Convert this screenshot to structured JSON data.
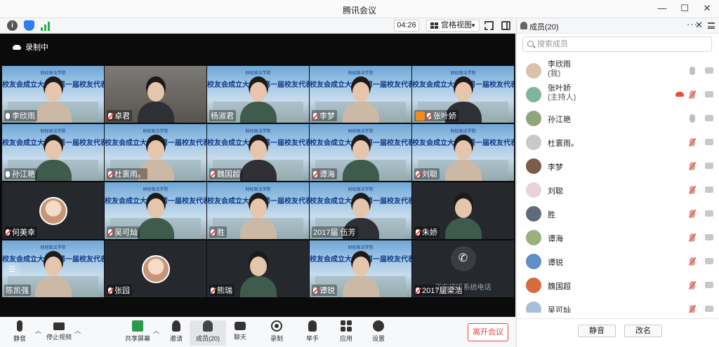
{
  "window": {
    "title": "腾讯会议"
  },
  "infobar": {
    "timer": "04:26",
    "view_mode": "宫格视图"
  },
  "stage": {
    "recording_label": "录制中"
  },
  "banner": {
    "title_text": "校友会成立大会暨第一届校友代表大会",
    "school_text": "财经政法学院"
  },
  "tiles": [
    {
      "name": "李欣雨",
      "style": "banner",
      "mic": "on"
    },
    {
      "name": "卓君",
      "style": "room",
      "mic": "off"
    },
    {
      "name": "杨淑君",
      "style": "banner",
      "mic": "none"
    },
    {
      "name": "李梦",
      "style": "banner",
      "mic": "off"
    },
    {
      "name": "张叶娇",
      "style": "banner",
      "mic": "off",
      "host": true
    },
    {
      "name": "孙江艳",
      "style": "banner",
      "mic": "on"
    },
    {
      "name": "杜寰雨。",
      "style": "banner",
      "mic": "off"
    },
    {
      "name": "魏国超",
      "style": "banner",
      "mic": "off"
    },
    {
      "name": "谭海",
      "style": "banner",
      "mic": "off"
    },
    {
      "name": "刘聪",
      "style": "banner",
      "mic": "off"
    },
    {
      "name": "何美幸",
      "style": "dark",
      "mic": "off"
    },
    {
      "name": "吴可灿",
      "style": "banner",
      "mic": "off"
    },
    {
      "name": "胜",
      "style": "banner",
      "mic": "off"
    },
    {
      "name": "2017届 伍芳",
      "style": "banner",
      "mic": "none"
    },
    {
      "name": "朱娇",
      "style": "dark",
      "mic": "off"
    },
    {
      "name": "陈凯强",
      "style": "banner",
      "mic": "none"
    },
    {
      "name": "张园",
      "style": "dark",
      "mic": "off"
    },
    {
      "name": "熊瑞",
      "style": "dark",
      "mic": "off"
    },
    {
      "name": "谭锐",
      "style": "banner",
      "mic": "off"
    },
    {
      "name": "2017届梁浩",
      "style": "dark",
      "mic": "off",
      "phone_label": "正在接听系统电话"
    }
  ],
  "toolbar": {
    "mute": "静音",
    "stop_video": "停止视频",
    "share_screen": "共享屏幕",
    "invite": "邀请",
    "members": "成员(20)",
    "chat": "聊天",
    "record": "录制",
    "raise_hand": "举手",
    "apps": "应用",
    "settings": "设置",
    "leave": "离开会议"
  },
  "members_panel": {
    "title": "成员(20)",
    "search_placeholder": "搜索成员",
    "mute_all": "静音",
    "rename": "改名",
    "items": [
      {
        "name": "李欣雨",
        "sub": "(我)",
        "mic": "on",
        "cam": "on"
      },
      {
        "name": "张叶娇",
        "sub": "(主持人)",
        "mic": "off",
        "cam": "on",
        "recording": true
      },
      {
        "name": "孙江艳",
        "sub": "",
        "mic": "on",
        "cam": "on"
      },
      {
        "name": "杜寰雨。",
        "sub": "",
        "mic": "off",
        "cam": "on"
      },
      {
        "name": "李梦",
        "sub": "",
        "mic": "off",
        "cam": "on"
      },
      {
        "name": "刘聪",
        "sub": "",
        "mic": "off",
        "cam": "on"
      },
      {
        "name": "胜",
        "sub": "",
        "mic": "off",
        "cam": "on"
      },
      {
        "name": "谭海",
        "sub": "",
        "mic": "off",
        "cam": "on"
      },
      {
        "name": "谭锐",
        "sub": "",
        "mic": "off",
        "cam": "on"
      },
      {
        "name": "魏国超",
        "sub": "",
        "mic": "off",
        "cam": "on"
      },
      {
        "name": "吴可灿",
        "sub": "",
        "mic": "off",
        "cam": "on"
      }
    ]
  },
  "colors": {
    "accent": "#2f7cf6",
    "leave": "#e9433b",
    "mic_off": "#ff3b30"
  }
}
